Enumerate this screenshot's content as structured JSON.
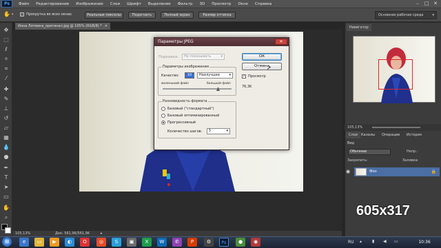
{
  "menubar": {
    "logo": "Ps",
    "items": [
      "Файл",
      "Редактирование",
      "Изображение",
      "Слои",
      "Шрифт",
      "Выделение",
      "Фильтр",
      "3D",
      "Просмотр",
      "Окно",
      "Справка"
    ]
  },
  "options": {
    "scroll_all": "Прокрутка во всех окнах",
    "real_pixels": "Реальные пикселы",
    "fit": "Подогнать",
    "fullscreen": "Полный экран",
    "print_size": "Размер оттиска",
    "workspace": "Основная рабочая среда"
  },
  "document": {
    "tab_title": "Инна Литвина_оригинал.jpg @ 105% (RGB/8) *",
    "zoom": "105,13%",
    "doc_info": "Док: 561,9K/561,9K"
  },
  "dialog": {
    "title": "Параметры JPEG",
    "matte_label": "Подложка:",
    "matte_value": "Не показывать",
    "image_options": "Параметры изображения",
    "quality_label": "Качество:",
    "quality_value": "10",
    "quality_preset": "Наилучшее",
    "small_file": "маленький файл",
    "large_file": "большой файл",
    "format_options": "Разновидность формата",
    "baseline": "Базовый (\"стандартный\")",
    "baseline_optimized": "Базовый оптимизированный",
    "progressive": "Прогрессивный",
    "scans_label": "Количество шагов:",
    "scans_value": "5",
    "ok": "ОК",
    "cancel": "Отмена",
    "preview": "Просмотр",
    "file_size": "76,3K",
    "close": "✕"
  },
  "navigator": {
    "tab": "Навигатор",
    "zoom": "105,13%"
  },
  "layers": {
    "tabs": [
      "Слои",
      "Каналы",
      "Операции",
      "История"
    ],
    "kind_label": "Вид",
    "blend_mode": "Обычные",
    "opacity_label": "Непр.:",
    "lock_label": "Закрепить:",
    "fill_label": "Заливка:",
    "layer_name": "Фон"
  },
  "overlay": {
    "text": "605x317"
  },
  "taskbar": {
    "lang": "RU",
    "time": "10:36"
  },
  "colors": {
    "ps_bg": "#535353",
    "dialog_title": "#5a353b",
    "selection": "#4b6ea3",
    "nav_frame": "#e0262a"
  }
}
